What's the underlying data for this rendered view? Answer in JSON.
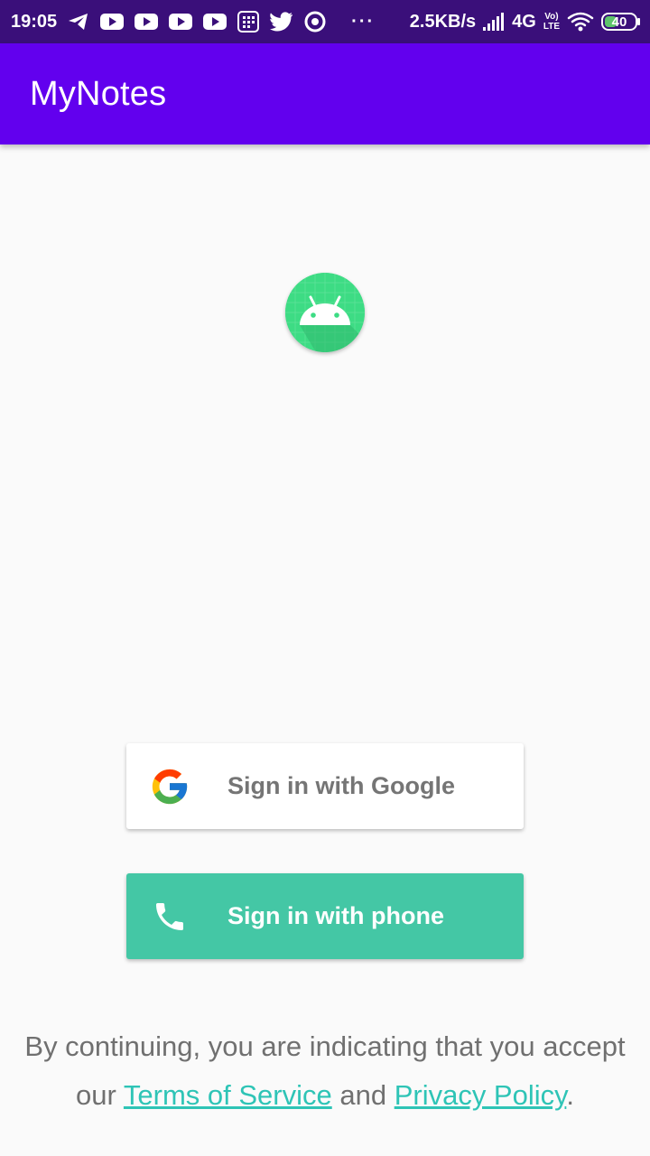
{
  "status_bar": {
    "time": "19:05",
    "more": "···",
    "speed": "2.5KB/s",
    "network": "4G",
    "volte_top": "Vo)",
    "volte_bottom": "LTE",
    "battery": "40"
  },
  "app_bar": {
    "title": "MyNotes"
  },
  "logo": {
    "icon": "android-icon"
  },
  "buttons": {
    "google": {
      "label": "Sign in with Google",
      "icon": "google-g-icon"
    },
    "phone": {
      "label": "Sign in with phone",
      "icon": "phone-icon"
    }
  },
  "terms": {
    "line1": "By continuing, you are indicating that you accept",
    "prefix": "our ",
    "terms_link": "Terms of Service",
    "middle": " and ",
    "privacy_link": "Privacy Policy",
    "suffix": "."
  },
  "colors": {
    "status_bar": "#3a0f7a",
    "app_bar": "#6200ee",
    "phone_button": "#44c7a5",
    "link": "#2ec4b6",
    "android_green": "#3ddc84"
  }
}
